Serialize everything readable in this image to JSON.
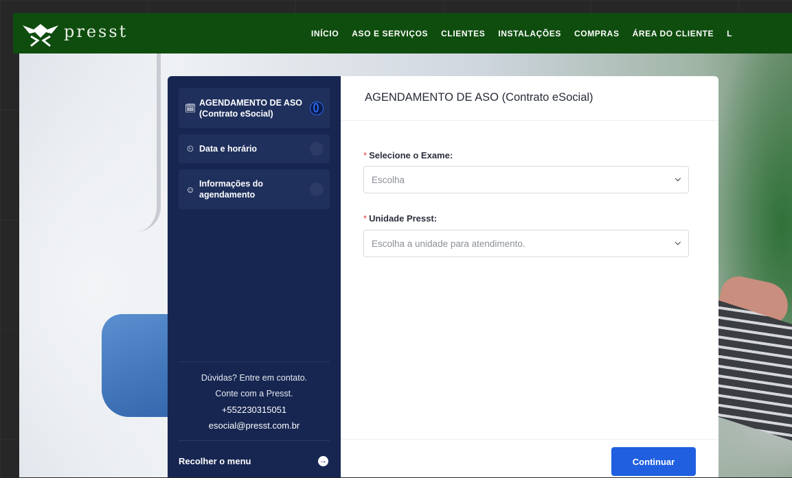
{
  "brand": {
    "name": "presst"
  },
  "nav": {
    "items": [
      {
        "label": "INÍCIO"
      },
      {
        "label": "ASO E SERVIÇOS"
      },
      {
        "label": "CLIENTES"
      },
      {
        "label": "INSTALAÇÕES"
      },
      {
        "label": "COMPRAS"
      },
      {
        "label": "ÁREA DO CLIENTE"
      },
      {
        "label": "L"
      }
    ]
  },
  "sidebar": {
    "steps": [
      {
        "line1": "AGENDAMENTO DE ASO",
        "line2": "(Contrato eSocial)",
        "icon": "calendar-check-icon",
        "status": "active"
      },
      {
        "line1": "Data e horário",
        "line2": "",
        "icon": "clock-icon",
        "status": "pending"
      },
      {
        "line1": "Informações do",
        "line2": "agendamento",
        "icon": "user-icon",
        "status": "pending"
      }
    ],
    "contact": {
      "line1": "Dúvidas? Entre em contato.",
      "line2": "Conte com a Presst.",
      "phone": "+552230315051",
      "email": "esocial@presst.com.br"
    },
    "collapse_label": "Recolher o menu"
  },
  "form": {
    "title": "AGENDAMENTO DE ASO (Contrato eSocial)",
    "exam": {
      "label": "Selecione o Exame:",
      "placeholder": "Escolha"
    },
    "unit": {
      "label": "Unidade Presst:",
      "placeholder": "Escolha a unidade para atendimento."
    },
    "required_marker": "*",
    "continue_label": "Continuar"
  },
  "colors": {
    "navbar": "#0f4d0f",
    "sidebar": "#162651",
    "accent": "#1f5fe0",
    "required": "#e03a3a"
  }
}
